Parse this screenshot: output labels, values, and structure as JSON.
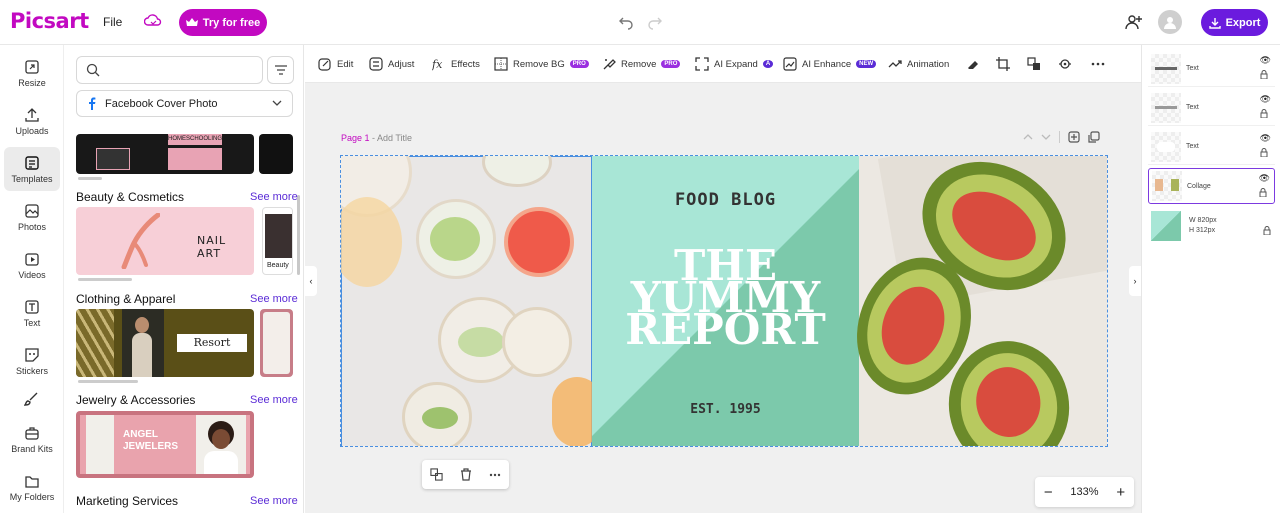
{
  "topbar": {
    "logo": "Picsart",
    "file": "File",
    "try_label": "Try for free",
    "export_label": "Export"
  },
  "rail": [
    {
      "label": "Resize",
      "icon": "resize-icon"
    },
    {
      "label": "Uploads",
      "icon": "upload-icon"
    },
    {
      "label": "Templates",
      "icon": "templates-icon",
      "active": true
    },
    {
      "label": "Photos",
      "icon": "photos-icon"
    },
    {
      "label": "Videos",
      "icon": "videos-icon"
    },
    {
      "label": "Text",
      "icon": "text-icon"
    },
    {
      "label": "Stickers",
      "icon": "stickers-icon"
    },
    {
      "label": "",
      "icon": "brush-icon"
    },
    {
      "label": "Brand Kits",
      "icon": "brand-kit-icon"
    },
    {
      "label": "My Folders",
      "icon": "folder-icon"
    }
  ],
  "panel": {
    "search_placeholder": "",
    "dropdown": "Facebook Cover Photo",
    "sections": [
      {
        "title": "Beauty & Cosmetics",
        "see_more": "See more",
        "card_text": "NAIL ART",
        "card2_text": "Beauty"
      },
      {
        "title": "Clothing & Apparel",
        "see_more": "See more",
        "card_text": "Resort"
      },
      {
        "title": "Jewelry & Accessories",
        "see_more": "See more",
        "card_text": "ANGEL JEWELERS"
      },
      {
        "title": "Marketing Services",
        "see_more": "See more"
      }
    ],
    "top_card_text": "HOMESCHOOLING"
  },
  "toolbar": [
    {
      "label": "Edit",
      "icon": "edit-icon"
    },
    {
      "label": "Adjust",
      "icon": "adjust-icon"
    },
    {
      "label": "Effects",
      "icon": "effects-icon"
    },
    {
      "label": "Remove BG",
      "icon": "remove-bg-icon",
      "badge": "PRO"
    },
    {
      "label": "Remove",
      "icon": "eraser-icon",
      "badge": "PRO"
    },
    {
      "label": "AI Expand",
      "icon": "expand-icon",
      "badge": "A"
    },
    {
      "label": "AI Enhance",
      "icon": "enhance-icon",
      "badge": "NEW"
    },
    {
      "label": "Animation",
      "icon": "animation-icon"
    }
  ],
  "canvas": {
    "page_label": "Page 1",
    "add_title": " - Add Title",
    "headline_top": "FOOD BLOG",
    "headline": [
      "THE",
      "YUMMY",
      "REPORT"
    ],
    "est": "EST. 1995",
    "zoom": "133%"
  },
  "layers": [
    {
      "name": "Text"
    },
    {
      "name": "Text"
    },
    {
      "name": "Text"
    },
    {
      "name": "Collage",
      "active": true
    },
    {
      "name": "",
      "w": "W  820px",
      "h": "H  312px"
    }
  ],
  "colors": {
    "brand": "#c209c1",
    "export": "#6b1bde",
    "mint": "#a8e6d6",
    "teal": "#7cc9ab"
  }
}
